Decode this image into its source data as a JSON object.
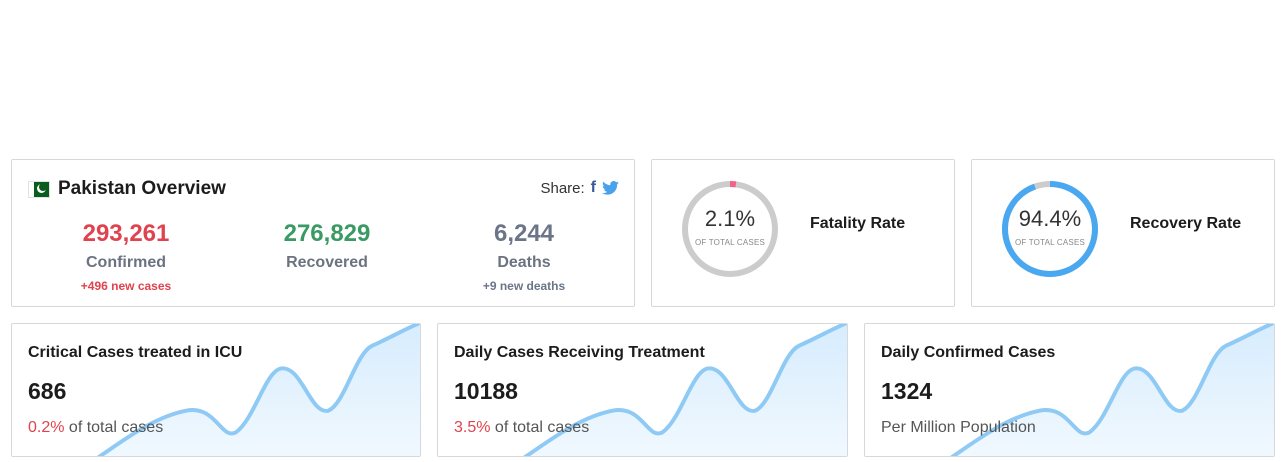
{
  "overview": {
    "title": "Pakistan Overview",
    "share_label": "Share:",
    "facebook_glyph": "f",
    "confirmed": {
      "value": "293,261",
      "label": "Confirmed",
      "sub": "+496 new cases",
      "color": "#e0424e"
    },
    "recovered": {
      "value": "276,829",
      "label": "Recovered",
      "sub": "",
      "color": "#3a9a63"
    },
    "deaths": {
      "value": "6,244",
      "label": "Deaths",
      "sub": "+9 new deaths",
      "color": "#6b7489"
    }
  },
  "fatality": {
    "value": "2.1%",
    "sub": "OF TOTAL CASES",
    "label": "Fatality Rate",
    "fraction": 0.021,
    "color": "#f06488"
  },
  "recovery": {
    "value": "94.4%",
    "sub": "OF TOTAL CASES",
    "label": "Recovery Rate",
    "fraction": 0.944,
    "color": "#4aa8f0"
  },
  "cards": {
    "icu": {
      "title": "Critical Cases treated in ICU",
      "value": "686",
      "pct": "0.2%",
      "foot": " of total cases"
    },
    "treatment": {
      "title": "Daily Cases Receiving Treatment",
      "value": "10188",
      "pct": "3.5%",
      "foot": " of total cases"
    },
    "daily": {
      "title": "Daily Confirmed Cases",
      "value": "1324",
      "foot": "Per Million Population"
    }
  },
  "colors": {
    "sparkline": "#8fcaf5",
    "donut_track": "#cccccc"
  },
  "icons": [
    "pakistan-flag-icon",
    "facebook-icon",
    "twitter-icon"
  ]
}
